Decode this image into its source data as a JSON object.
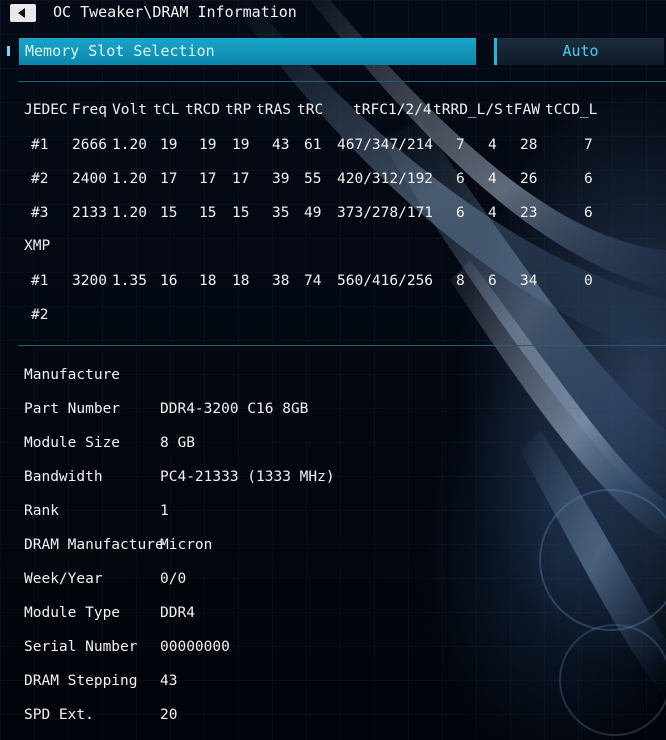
{
  "title_bar": {
    "path": "OC Tweaker\\DRAM Information"
  },
  "slot_selection": {
    "label": "Memory Slot Selection",
    "value": "Auto"
  },
  "timings": {
    "headers": [
      "JEDEC",
      "Freq",
      "Volt",
      "tCL",
      "tRCD",
      "tRP",
      "tRAS",
      "tRC",
      "tRFC1/2/4",
      "tRRD_L/S",
      "tFAW",
      "tCCD_L"
    ],
    "jedec_rows": [
      {
        "id": "#1",
        "freq": "2666",
        "volt": "1.20",
        "tcl": "19",
        "trcd": "19",
        "trp": "19",
        "tras": "43",
        "trc": "61",
        "trfc": "467/347/214",
        "trrd_l": "7",
        "trrd_s": "4",
        "tfaw": "28",
        "tccd_l": "7"
      },
      {
        "id": "#2",
        "freq": "2400",
        "volt": "1.20",
        "tcl": "17",
        "trcd": "17",
        "trp": "17",
        "tras": "39",
        "trc": "55",
        "trfc": "420/312/192",
        "trrd_l": "6",
        "trrd_s": "4",
        "tfaw": "26",
        "tccd_l": "6"
      },
      {
        "id": "#3",
        "freq": "2133",
        "volt": "1.20",
        "tcl": "15",
        "trcd": "15",
        "trp": "15",
        "tras": "35",
        "trc": "49",
        "trfc": "373/278/171",
        "trrd_l": "6",
        "trrd_s": "4",
        "tfaw": "23",
        "tccd_l": "6"
      }
    ],
    "xmp_label": "XMP",
    "xmp_rows": [
      {
        "id": "#1",
        "freq": "3200",
        "volt": "1.35",
        "tcl": "16",
        "trcd": "18",
        "trp": "18",
        "tras": "38",
        "trc": "74",
        "trfc": "560/416/256",
        "trrd_l": "8",
        "trrd_s": "6",
        "tfaw": "34",
        "tccd_l": "0"
      },
      {
        "id": "#2"
      }
    ]
  },
  "info": [
    {
      "label": "Manufacture",
      "value": ""
    },
    {
      "label": "Part Number",
      "value": "DDR4-3200 C16 8GB"
    },
    {
      "label": "Module Size",
      "value": "8 GB"
    },
    {
      "label": "Bandwidth",
      "value": "PC4-21333 (1333 MHz)"
    },
    {
      "label": "Rank",
      "value": "1"
    },
    {
      "label": "DRAM Manufacture",
      "value": "Micron"
    },
    {
      "label": "Week/Year",
      "value": "0/0"
    },
    {
      "label": "Module Type",
      "value": "DDR4"
    },
    {
      "label": "Serial Number",
      "value": "00000000"
    },
    {
      "label": "DRAM Stepping",
      "value": "43"
    },
    {
      "label": "SPD Ext.",
      "value": "20"
    }
  ],
  "colors": {
    "accent": "#0b86ab",
    "accent_text": "#48cdf0",
    "divider": "#285c73"
  }
}
